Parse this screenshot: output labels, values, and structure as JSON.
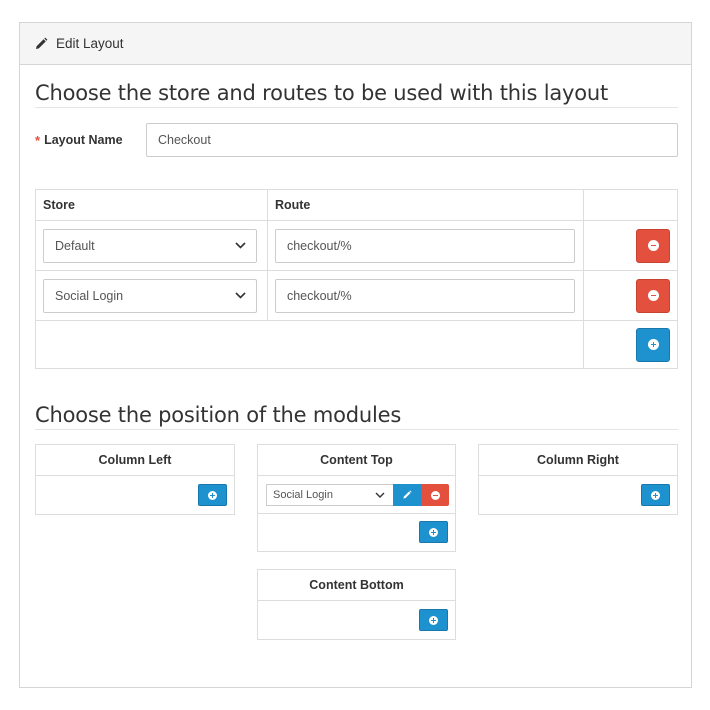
{
  "panel": {
    "heading": "Edit Layout",
    "icon": "pencil-icon"
  },
  "section1": {
    "title": "Choose the store and routes to be used with this layout"
  },
  "layout_name": {
    "required_mark": "*",
    "label": "Layout Name",
    "value": "Checkout"
  },
  "routes_table": {
    "headers": {
      "store": "Store",
      "route": "Route"
    },
    "rows": [
      {
        "store": "Default",
        "route": "checkout/%"
      },
      {
        "store": "Social Login",
        "route": "checkout/%"
      }
    ]
  },
  "section2": {
    "title": "Choose the position of the modules"
  },
  "positions": {
    "column_left": {
      "title": "Column Left"
    },
    "content_top": {
      "title": "Content Top",
      "module": "Social Login"
    },
    "column_right": {
      "title": "Column Right"
    },
    "content_bottom": {
      "title": "Content Bottom"
    }
  },
  "colors": {
    "primary": "#1e91cf",
    "danger": "#e3503e",
    "required": "#e3503e",
    "heading_bg": "#f5f5f5"
  }
}
